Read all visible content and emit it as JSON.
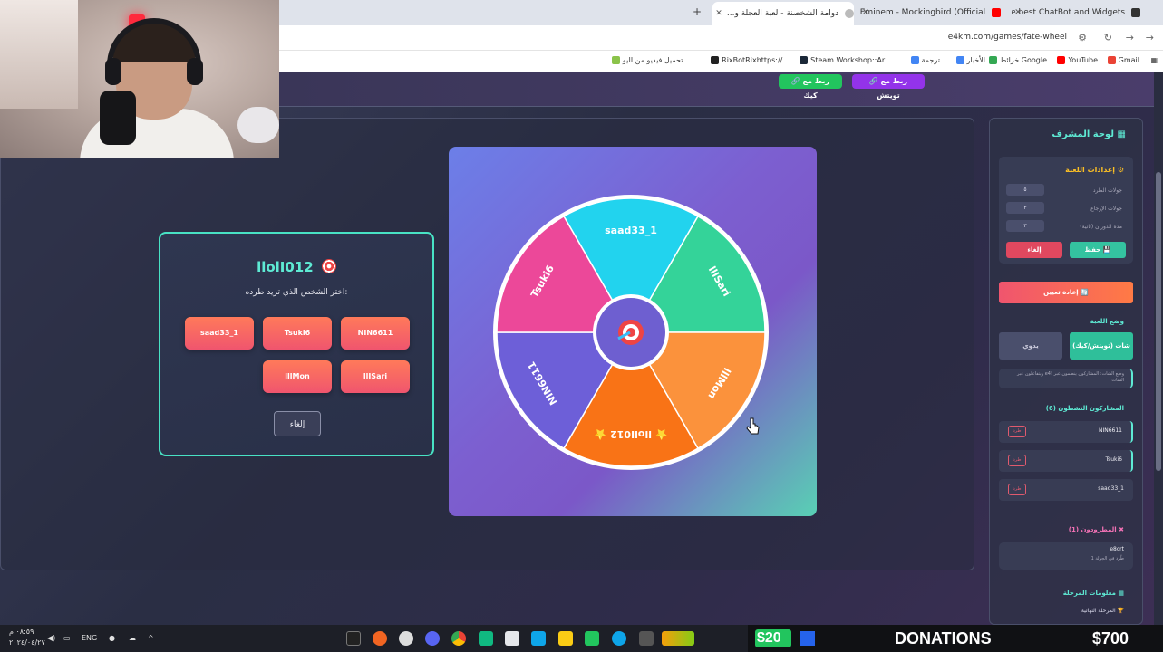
{
  "browser": {
    "tabs": [
      {
        "title": "The best ChatBot and Widgets",
        "color": "#333"
      },
      {
        "title": "Eminem - Mockingbird (Official",
        "color": "#ff0000"
      },
      {
        "title": "دوامة الشخصنة - لعبة العجلة و...",
        "color": "#777"
      }
    ],
    "new_tab": "+",
    "url": "e4km.com/games/fate-wheel",
    "bookmarks": [
      "Gmail",
      "YouTube",
      "خرائط Google",
      "الأخبار",
      "ترجمة",
      "Steam Workshop::Ar...",
      "RixBotRixhttps://...",
      "تحميل فيديو من اليو..."
    ]
  },
  "page": {
    "top_buttons": {
      "kick": "🔗 ربط مع كيك",
      "twitch": "🔗 ربط مع تويتش"
    },
    "wheel": {
      "segments": [
        {
          "label": "saad33_1",
          "color": "#22d3ee"
        },
        {
          "label": "llISari",
          "color": "#34d399"
        },
        {
          "label": "lllMon",
          "color": "#fb923c"
        },
        {
          "label": "⭐ llolI012 ⭐",
          "color": "#f97316"
        },
        {
          "label": "NIN6611",
          "color": "#6d5fd8"
        },
        {
          "label": "Tsuki6",
          "color": "#ec4899"
        }
      ]
    },
    "elimination": {
      "title": "llolI012",
      "subtitle": "اختر الشخص الذي تريد طرده:",
      "players": [
        "saad33_1",
        "Tsuki6",
        "NIN6611",
        "lllMon",
        "llISari"
      ],
      "cancel": "إلغاء"
    }
  },
  "sidebar": {
    "title": "لوحة المشرف",
    "settings_title": "إعدادات اللعبة",
    "settings": [
      {
        "label": "جولات الطرد",
        "value": "٥"
      },
      {
        "label": "جولات الإرجاع",
        "value": "٣"
      },
      {
        "label": "مدة الدوران (ثانية)",
        "value": "٣"
      }
    ],
    "save": "💾 حفظ",
    "cancel": "إلغاء",
    "reset": "🔄 إعادة تعيين",
    "mode_title": "وضع اللعبة",
    "mode_chat": "شات (تويتش/كيك)",
    "mode_manual": "يدوي",
    "mode_note": "وضع الشات: المشاركون ينضمون عبر !e4 ويتفاعلون عبر الشات",
    "active_title": "المشاركون النشطون (6)",
    "active_players": [
      "NIN6611",
      "Tsuki6",
      "saad33_1"
    ],
    "kick_label": "طرد",
    "eliminated_title": "المطرودون (1)",
    "eliminated": [
      {
        "name": "e8crt",
        "note": "طُرد في الجولة 1"
      }
    ],
    "stage_title": "معلومات المرحلة",
    "stage_value": "🏆 المرحلة النهائية"
  },
  "taskbar": {
    "time": "٠٨:٥٩ م",
    "date": "٢٠٢٤/٠٤/٢٧",
    "lang": "ENG"
  },
  "donations": {
    "current": "$20",
    "label": "DONATIONS",
    "goal": "$700",
    "progress": 0.029
  }
}
